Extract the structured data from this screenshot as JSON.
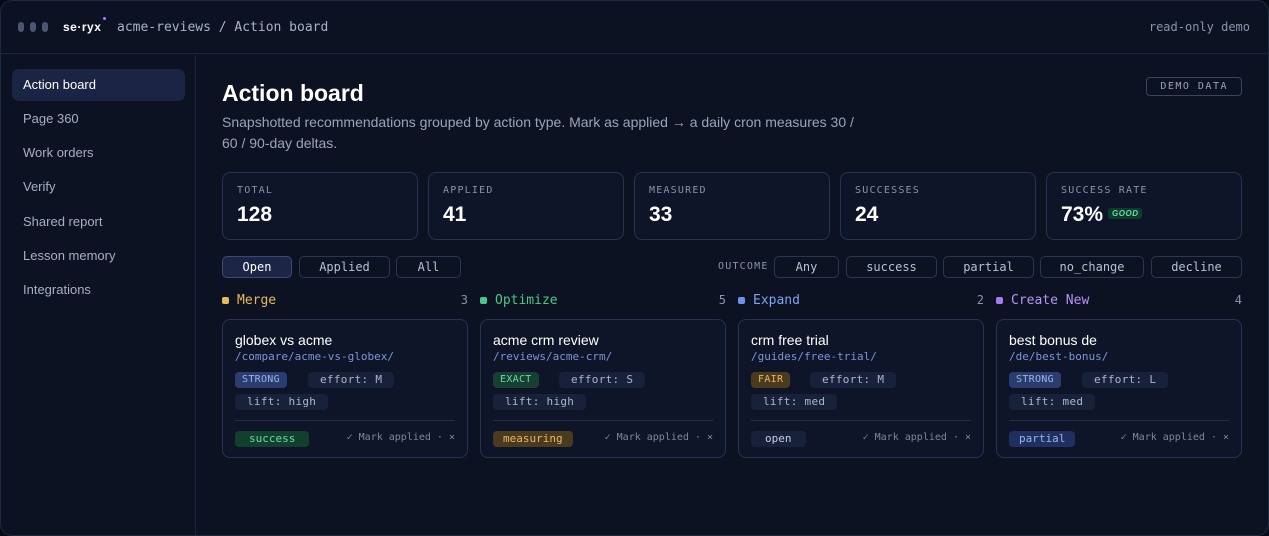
{
  "titlebar": {
    "logo": "se·ryx",
    "breadcrumb": "acme-reviews / Action board",
    "mode": "read-only demo"
  },
  "sidebar": {
    "items": [
      {
        "label": "Action board",
        "active": true
      },
      {
        "label": "Page 360"
      },
      {
        "label": "Work orders"
      },
      {
        "label": "Verify"
      },
      {
        "label": "Shared report"
      },
      {
        "label": "Lesson memory"
      },
      {
        "label": "Integrations"
      }
    ]
  },
  "header": {
    "title": "Action board",
    "demo_badge": "DEMO DATA",
    "subtitle_line1": "Snapshotted recommendations grouped by action type. Mark as applied → a daily cron measures 30 /",
    "subtitle_line2": "60 / 90-day deltas."
  },
  "stats": [
    {
      "label": "TOTAL",
      "value": "128"
    },
    {
      "label": "APPLIED",
      "value": "41"
    },
    {
      "label": "MEASURED",
      "value": "33"
    },
    {
      "label": "SUCCESSES",
      "value": "24"
    },
    {
      "label": "SUCCESS RATE",
      "value": "73%",
      "badge": "GOOD"
    }
  ],
  "filters": {
    "state": [
      "Open",
      "Applied",
      "All"
    ],
    "state_selected": "Open",
    "outcome_label": "OUTCOME",
    "outcome": [
      "Any",
      "success",
      "partial",
      "no_change",
      "decline"
    ]
  },
  "groups": [
    {
      "name": "Merge",
      "count": "3",
      "color": "#e9b85a",
      "card": {
        "title": "globex vs acme",
        "path": "/compare/acme-vs-globex/",
        "match": "STRONG",
        "effort": "effort: M",
        "lift": "lift: high",
        "status": "success",
        "action": "✓ Mark applied · ×"
      }
    },
    {
      "name": "Optimize",
      "count": "5",
      "color": "#48c98a",
      "card": {
        "title": "acme crm review",
        "path": "/reviews/acme-crm/",
        "match": "EXACT",
        "effort": "effort: S",
        "lift": "lift: high",
        "status": "measuring",
        "action": "✓ Mark applied · ×"
      }
    },
    {
      "name": "Expand",
      "count": "2",
      "color": "#6c93e8",
      "card": {
        "title": "crm free trial",
        "path": "/guides/free-trial/",
        "match": "FAIR",
        "effort": "effort: M",
        "lift": "lift: med",
        "status": "open",
        "action": "✓ Mark applied · ×"
      }
    },
    {
      "name": "Create New",
      "count": "4",
      "color": "#a57cf0",
      "card": {
        "title": "best bonus de",
        "path": "/de/best-bonus/",
        "match": "STRONG",
        "effort": "effort: L",
        "lift": "lift: med",
        "status": "partial",
        "action": "✓ Mark applied · ×"
      }
    }
  ],
  "colors": {
    "match_STRONG": "#2a3d6e",
    "match_EXACT": "#173f34",
    "match_FAIR": "#4a3a1e",
    "status_success": "#123f30",
    "status_measuring": "#4a3a1e",
    "status_open": "#18213a",
    "status_partial": "#1f2f60"
  }
}
